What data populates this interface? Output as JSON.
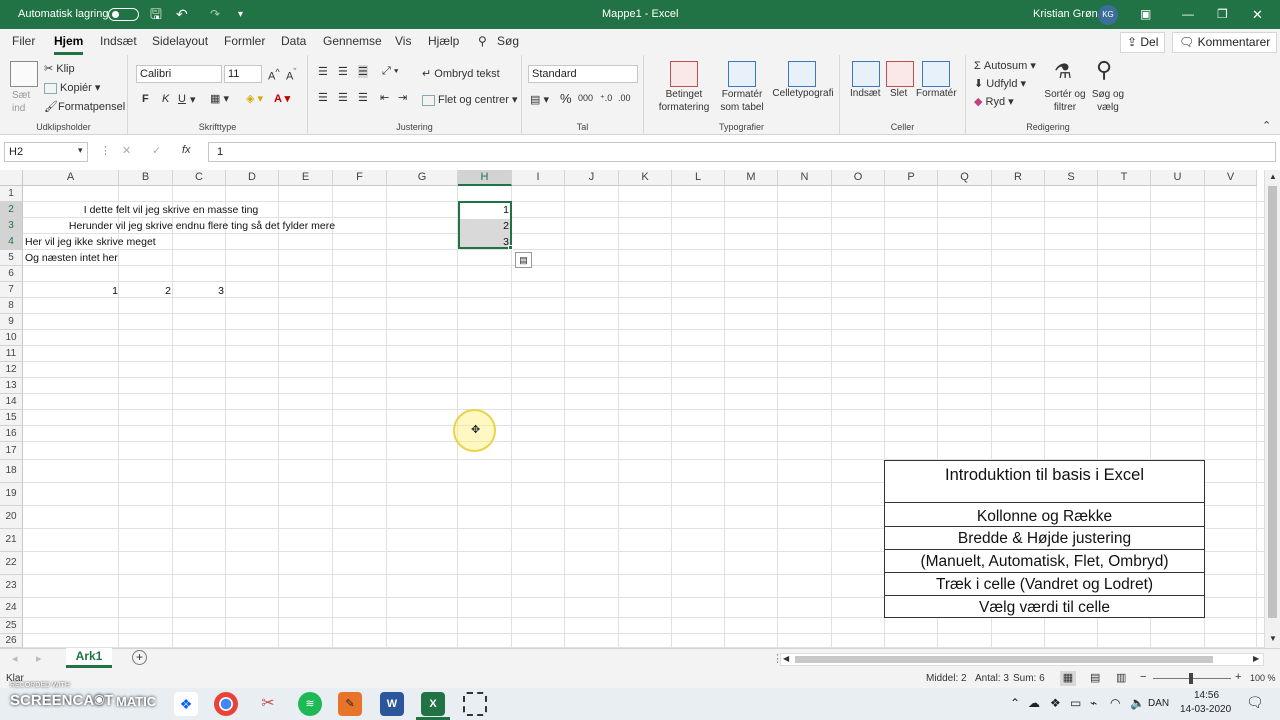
{
  "titlebar": {
    "autosave_label": "Automatisk lagring",
    "title": "Mappe1  -  Excel",
    "user_name": "Kristian Grøn",
    "user_initials": "KG",
    "accent": "#217346"
  },
  "menu": {
    "tabs": [
      "Filer",
      "Hjem",
      "Indsæt",
      "Sidelayout",
      "Formler",
      "Data",
      "Gennemse",
      "Vis",
      "Hjælp",
      "Søg"
    ],
    "share_label": "Del",
    "comments_label": "Kommentarer"
  },
  "ribbon": {
    "clipboard": {
      "paste_label": "Sæt ind",
      "cut": "Klip",
      "copy": "Kopiér",
      "format_painter": "Formatpensel",
      "group": "Udklipsholder"
    },
    "font": {
      "family": "Calibri",
      "size": "11",
      "bold": "F",
      "italic": "K",
      "underline": "U",
      "group": "Skrifttype"
    },
    "alignment": {
      "wrap": "Ombryd tekst",
      "merge": "Flet og centrer",
      "group": "Justering"
    },
    "number": {
      "format": "Standard",
      "group": "Tal"
    },
    "styles": {
      "conditional": "Betinget formatering",
      "format_table": "Formatér som tabel",
      "cell_styles": "Celletypografi",
      "group": "Typografier"
    },
    "cells": {
      "insert": "Indsæt",
      "delete": "Slet",
      "format": "Formatér",
      "group": "Celler"
    },
    "editing": {
      "autosum": "Autosum",
      "fill": "Udfyld",
      "clear": "Ryd",
      "sort": "Sortér og filtrer",
      "find": "Søg og vælg",
      "group": "Redigering"
    }
  },
  "formula_bar": {
    "name_box": "H2",
    "fx": "fx",
    "value": "1"
  },
  "grid": {
    "columns": [
      "A",
      "B",
      "C",
      "D",
      "E",
      "F",
      "G",
      "H",
      "I",
      "J",
      "K",
      "L",
      "M",
      "N",
      "O",
      "P",
      "Q",
      "R",
      "S",
      "T",
      "U",
      "V"
    ],
    "rows": [
      "1",
      "2",
      "3",
      "4",
      "5",
      "6",
      "7",
      "8",
      "9",
      "10",
      "11",
      "12",
      "13",
      "14",
      "15",
      "16",
      "17",
      "18",
      "19",
      "20",
      "21",
      "22",
      "23",
      "24",
      "25",
      "26"
    ],
    "cells": {
      "r2": "I dette felt vil jeg skrive en masse ting",
      "r3": "Herunder vil jeg skrive endnu flere ting så det fylder mere",
      "r4": "Her vil jeg ikke skrive meget",
      "r5": "Og næsten intet her",
      "a7": "1",
      "b7": "2",
      "c7": "3",
      "h2": "1",
      "h3": "2",
      "h4": "3"
    },
    "selected_column": "H"
  },
  "infobox": {
    "title": "Introduktion til basis i Excel",
    "items": [
      "Kollonne og Række",
      "Bredde & Højde justering",
      "(Manuelt, Automatisk, Flet, Ombryd)",
      "Træk i celle (Vandret og Lodret)",
      "Vælg værdi til celle"
    ]
  },
  "sheets": {
    "active": "Ark1"
  },
  "status": {
    "ready": "Klar",
    "average": "Middel: 2",
    "count": "Antal: 3",
    "sum": "Sum: 6",
    "zoom": "100 %"
  },
  "taskbar": {
    "watermark_small": "RECORDED WITH",
    "watermark_big": "SCREENCAST",
    "watermark_brand": "MATIC",
    "lang": "DAN",
    "time": "14:56",
    "date": "14-03-2020"
  }
}
